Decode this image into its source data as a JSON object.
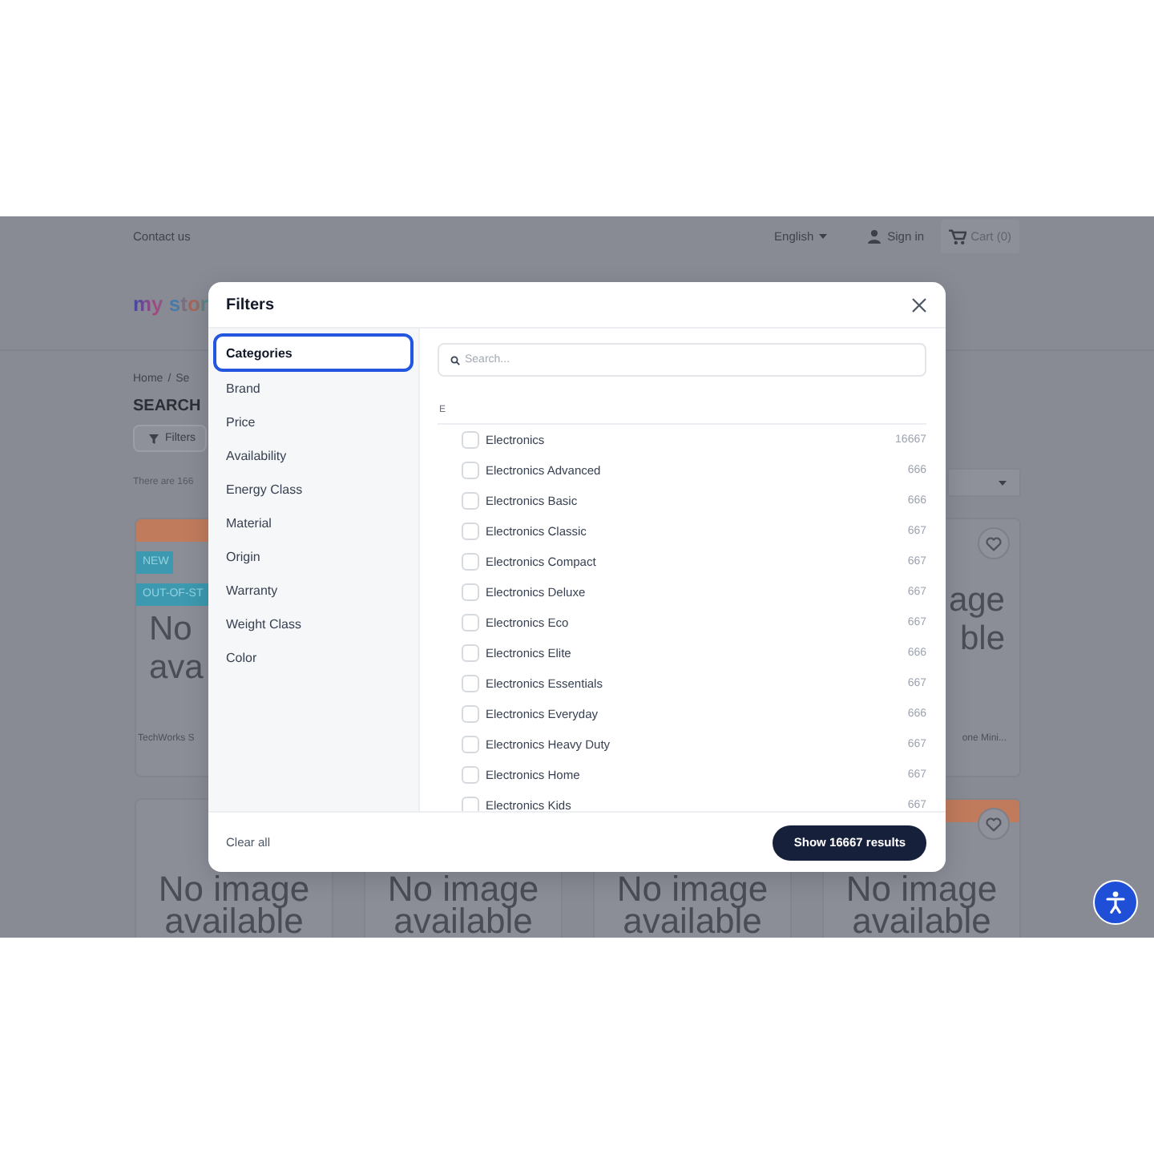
{
  "page": {
    "top_bar": {
      "contact": "Contact us",
      "language": "English",
      "sign_in": "Sign in",
      "cart": "Cart (0)"
    },
    "header": {
      "logo": "my stor"
    },
    "breadcrumb": {
      "items": [
        "Home",
        "Se"
      ],
      "separator": "/"
    },
    "heading": "SEARCH",
    "filters_button": "Filters",
    "results_count": "There are 166",
    "products": [
      {
        "kind": "partial-left",
        "banner": true,
        "badges": [
          "NEW",
          "OUT-OF-ST"
        ],
        "image_text": [
          "No",
          "ava"
        ],
        "title": "TechWorks S"
      },
      {
        "kind": "partial-right",
        "banner": false,
        "favorite_button": true,
        "image_text": [
          "age",
          "ble"
        ],
        "title": "one Mini..."
      },
      {
        "kind": "lower",
        "image_text": [
          "No image",
          "available"
        ]
      },
      {
        "kind": "lower",
        "image_text": [
          "No image",
          "available"
        ]
      },
      {
        "kind": "lower",
        "image_text": [
          "No image",
          "available"
        ]
      },
      {
        "kind": "lower",
        "banner": true,
        "favorite_button": true,
        "image_text": [
          "No image",
          "available"
        ]
      }
    ]
  },
  "filters_modal": {
    "title": "Filters",
    "categories": [
      {
        "label": "Categories",
        "selected": true
      },
      {
        "label": "Brand",
        "selected": false
      },
      {
        "label": "Price",
        "selected": false
      },
      {
        "label": "Availability",
        "selected": false
      },
      {
        "label": "Energy Class",
        "selected": false
      },
      {
        "label": "Material",
        "selected": false
      },
      {
        "label": "Origin",
        "selected": false
      },
      {
        "label": "Warranty",
        "selected": false
      },
      {
        "label": "Weight Class",
        "selected": false
      },
      {
        "label": "Color",
        "selected": false
      }
    ],
    "search": {
      "placeholder": "Search..."
    },
    "groups": [
      {
        "letter": "E",
        "options": [
          {
            "label": "Electronics",
            "count": "16667",
            "checked": false
          },
          {
            "label": "Electronics Advanced",
            "count": "666",
            "checked": false
          },
          {
            "label": "Electronics Basic",
            "count": "666",
            "checked": false
          },
          {
            "label": "Electronics Classic",
            "count": "667",
            "checked": false
          },
          {
            "label": "Electronics Compact",
            "count": "667",
            "checked": false
          },
          {
            "label": "Electronics Deluxe",
            "count": "667",
            "checked": false
          },
          {
            "label": "Electronics Eco",
            "count": "667",
            "checked": false
          },
          {
            "label": "Electronics Elite",
            "count": "666",
            "checked": false
          },
          {
            "label": "Electronics Essentials",
            "count": "667",
            "checked": false
          },
          {
            "label": "Electronics Everyday",
            "count": "666",
            "checked": false
          },
          {
            "label": "Electronics Heavy Duty",
            "count": "667",
            "checked": false
          },
          {
            "label": "Electronics Home",
            "count": "667",
            "checked": false
          },
          {
            "label": "Electronics Kids",
            "count": "667",
            "checked": false
          }
        ]
      }
    ],
    "clear_all": "Clear all",
    "apply_button": "Show 16667 results"
  }
}
